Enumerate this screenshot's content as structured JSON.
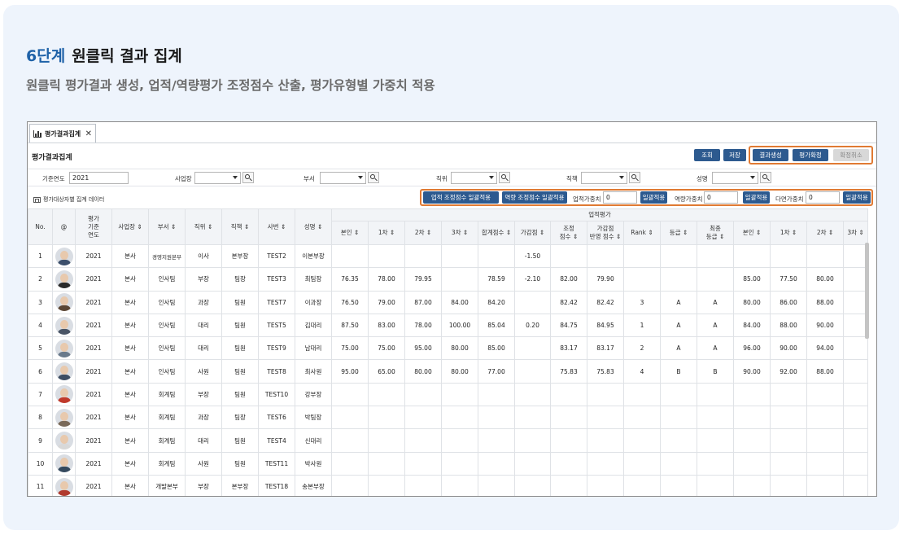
{
  "heading": {
    "step": "6단계",
    "title": "원클릭 결과 집계",
    "subtitle": "원클릭 평가결과 생성, 업적/역량평가 조정점수 산출, 평가유형별 가중치 적용"
  },
  "window": {
    "tab_label": "평가결과집계",
    "tab_close": "✕",
    "page_title": "평가결과집계",
    "toolbar": {
      "search": "조회",
      "save": "저장",
      "generate": "결과생성",
      "confirm": "평가확정",
      "cancel_confirm": "확정취소"
    },
    "filters": {
      "year_label": "기준연도",
      "year_value": "2021",
      "site_label": "사업장",
      "dept_label": "부서",
      "position_label": "직위",
      "duty_label": "직책",
      "name_label": "성명"
    },
    "subbar": {
      "title": "평가대상자별 집계 데이터",
      "perf_adjust_btn": "업적 조정점수 일괄적용",
      "comp_adjust_btn": "역량 조정점수 일괄적용",
      "perf_weight_label": "업적가중치",
      "perf_weight_value": "0",
      "comp_weight_label": "역량가중치",
      "comp_weight_value": "0",
      "multi_weight_label": "다면가중치",
      "multi_weight_value": "0",
      "apply_btn": "일괄적용"
    },
    "table": {
      "group_header": "업적평가",
      "headers": {
        "no": "No.",
        "at": "@",
        "year": [
          "평가",
          "기준",
          "연도"
        ],
        "site": "사업장 ⇕",
        "dept": "부서 ⇕",
        "position": "직위 ⇕",
        "duty": "직책 ⇕",
        "emp_no": "사번 ⇕",
        "name": "성명 ⇕",
        "self": "본인 ⇕",
        "first": "1차 ⇕",
        "second": "2차 ⇕",
        "third": "3차 ⇕",
        "total": "합계점수 ⇕",
        "adjust_pts": "가감점 ⇕",
        "adjusted": [
          "조정",
          "점수 ⇕"
        ],
        "adjust_applied": [
          "가감점",
          "반영 점수 ⇕"
        ],
        "rank": "Rank ⇕",
        "grade": "등급 ⇕",
        "final_grade": [
          "최종",
          "등급 ⇕"
        ],
        "self2": "본인 ⇕",
        "first2": "1차 ⇕",
        "second2": "2차 ⇕",
        "third2": "3차 ⇕"
      },
      "rows": [
        {
          "no": "1",
          "year": "2021",
          "site": "본사",
          "dept": "경영지원본부",
          "pos": "이사",
          "duty": "본부장",
          "emp": "TEST2",
          "name": "이본부장",
          "self": "",
          "r1": "",
          "r2": "",
          "r3": "",
          "total": "",
          "adj": "-1.50",
          "adjusted": "",
          "applied": "",
          "rank": "",
          "grade": "",
          "final": "",
          "s2": "",
          "f2": "",
          "sc2": "",
          "avatar": "#3c4f6b"
        },
        {
          "no": "2",
          "year": "2021",
          "site": "본사",
          "dept": "인사팀",
          "pos": "부장",
          "duty": "팀장",
          "emp": "TEST3",
          "name": "최팀장",
          "self": "76.35",
          "r1": "78.00",
          "r2": "79.95",
          "r3": "",
          "total": "78.59",
          "adj": "-2.10",
          "adjusted": "82.00",
          "applied": "79.90",
          "rank": "",
          "grade": "",
          "final": "",
          "s2": "85.00",
          "f2": "77.50",
          "sc2": "80.00",
          "avatar": "#2a2a2a"
        },
        {
          "no": "3",
          "year": "2021",
          "site": "본사",
          "dept": "인사팀",
          "pos": "과장",
          "duty": "팀원",
          "emp": "TEST7",
          "name": "이과장",
          "self": "76.50",
          "r1": "79.00",
          "r2": "87.00",
          "r3": "84.00",
          "total": "84.20",
          "adj": "",
          "adjusted": "82.42",
          "applied": "82.42",
          "rank": "3",
          "grade": "A",
          "final": "A",
          "s2": "80.00",
          "f2": "86.00",
          "sc2": "88.00",
          "avatar": "#5b4634"
        },
        {
          "no": "4",
          "year": "2021",
          "site": "본사",
          "dept": "인사팀",
          "pos": "대리",
          "duty": "팀원",
          "emp": "TEST5",
          "name": "김대리",
          "self": "87.50",
          "r1": "83.00",
          "r2": "78.00",
          "r3": "100.00",
          "total": "85.04",
          "adj": "0.20",
          "adjusted": "84.75",
          "applied": "84.95",
          "rank": "1",
          "grade": "A",
          "final": "A",
          "s2": "84.00",
          "f2": "88.00",
          "sc2": "90.00",
          "avatar": "#4a5566"
        },
        {
          "no": "5",
          "year": "2021",
          "site": "본사",
          "dept": "인사팀",
          "pos": "대리",
          "duty": "팀원",
          "emp": "TEST9",
          "name": "남대리",
          "self": "75.00",
          "r1": "75.00",
          "r2": "95.00",
          "r3": "80.00",
          "total": "85.00",
          "adj": "",
          "adjusted": "83.17",
          "applied": "83.17",
          "rank": "2",
          "grade": "A",
          "final": "A",
          "s2": "96.00",
          "f2": "90.00",
          "sc2": "94.00",
          "avatar": "#6a7a8c"
        },
        {
          "no": "6",
          "year": "2021",
          "site": "본사",
          "dept": "인사팀",
          "pos": "사원",
          "duty": "팀원",
          "emp": "TEST8",
          "name": "최사원",
          "self": "95.00",
          "r1": "65.00",
          "r2": "80.00",
          "r3": "80.00",
          "total": "77.00",
          "adj": "",
          "adjusted": "75.83",
          "applied": "75.83",
          "rank": "4",
          "grade": "B",
          "final": "B",
          "s2": "90.00",
          "f2": "92.00",
          "sc2": "88.00",
          "avatar": "#3d4d63"
        },
        {
          "no": "7",
          "year": "2021",
          "site": "본사",
          "dept": "회계팀",
          "pos": "부장",
          "duty": "팀원",
          "emp": "TEST10",
          "name": "강부장",
          "self": "",
          "r1": "",
          "r2": "",
          "r3": "",
          "total": "",
          "adj": "",
          "adjusted": "",
          "applied": "",
          "rank": "",
          "grade": "",
          "final": "",
          "s2": "",
          "f2": "",
          "sc2": "",
          "avatar": "#c0392b"
        },
        {
          "no": "8",
          "year": "2021",
          "site": "본사",
          "dept": "회계팀",
          "pos": "과장",
          "duty": "팀장",
          "emp": "TEST6",
          "name": "박팀장",
          "self": "",
          "r1": "",
          "r2": "",
          "r3": "",
          "total": "",
          "adj": "",
          "adjusted": "",
          "applied": "",
          "rank": "",
          "grade": "",
          "final": "",
          "s2": "",
          "f2": "",
          "sc2": "",
          "avatar": "#7a6a5a"
        },
        {
          "no": "9",
          "year": "2021",
          "site": "본사",
          "dept": "회계팀",
          "pos": "대리",
          "duty": "팀원",
          "emp": "TEST4",
          "name": "신대리",
          "self": "",
          "r1": "",
          "r2": "",
          "r3": "",
          "total": "",
          "adj": "",
          "adjusted": "",
          "applied": "",
          "rank": "",
          "grade": "",
          "final": "",
          "s2": "",
          "f2": "",
          "sc2": "",
          "avatar": "#d8d8d8"
        },
        {
          "no": "10",
          "year": "2021",
          "site": "본사",
          "dept": "회계팀",
          "pos": "사원",
          "duty": "팀원",
          "emp": "TEST11",
          "name": "박사원",
          "self": "",
          "r1": "",
          "r2": "",
          "r3": "",
          "total": "",
          "adj": "",
          "adjusted": "",
          "applied": "",
          "rank": "",
          "grade": "",
          "final": "",
          "s2": "",
          "f2": "",
          "sc2": "",
          "avatar": "#34495e"
        },
        {
          "no": "11",
          "year": "2021",
          "site": "본사",
          "dept": "개발본부",
          "pos": "부장",
          "duty": "본부장",
          "emp": "TEST18",
          "name": "송본부장",
          "self": "",
          "r1": "",
          "r2": "",
          "r3": "",
          "total": "",
          "adj": "",
          "adjusted": "",
          "applied": "",
          "rank": "",
          "grade": "",
          "final": "",
          "s2": "",
          "f2": "",
          "sc2": "",
          "avatar": "#b03a2e"
        }
      ]
    }
  },
  "colors": {
    "accent": "#1f62a8",
    "button": "#2d5a8f",
    "highlight": "#e07a33",
    "card_bg": "#eef4fc"
  }
}
